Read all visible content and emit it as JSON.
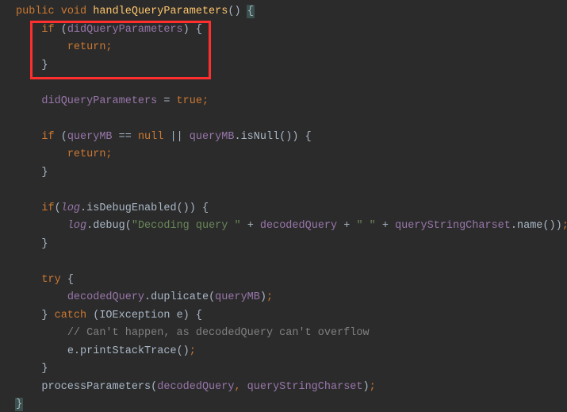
{
  "code": {
    "sig": {
      "public": "public",
      "void": "void",
      "name": "handleQueryParameters",
      "parens": "()",
      "ob": " {"
    },
    "if1": {
      "kw": "if",
      "open": " (",
      "var": "didQueryParameters",
      "close": ") {"
    },
    "ret1": {
      "kw": "return",
      "semi": ";"
    },
    "cb1": "}",
    "assign": {
      "var": "didQueryParameters",
      "eq": " = ",
      "val": "true",
      "semi": ";"
    },
    "if2": {
      "kw": "if",
      "open": " (",
      "var1": "queryMB",
      "eq1": " == ",
      "null1": "null",
      "or": " || ",
      "var2": "queryMB",
      "dot": ".",
      "call": "isNull",
      "parens": "()",
      "close": ") {"
    },
    "ret2": {
      "kw": "return",
      "semi": ";"
    },
    "cb2": "}",
    "if3": {
      "kw": "if",
      "open": "(",
      "var": "log",
      "dot": ".",
      "call": "isDebugEnabled",
      "parens": "()",
      "close": ") {"
    },
    "log": {
      "var": "log",
      "dot": ".",
      "call": "debug",
      "open": "(",
      "s1": "\"Decoding query \"",
      "p1": " + ",
      "v1": "decodedQuery",
      "p2": " + ",
      "s2": "\" \"",
      "p3": " + ",
      "v2": "queryStringCharset",
      "dot2": ".",
      "call2": "name",
      "parens2": "()",
      "close": ")",
      "semi": ";"
    },
    "cb3": "}",
    "try": {
      "kw": "try",
      "ob": " {"
    },
    "dup": {
      "v": "decodedQuery",
      "dot": ".",
      "call": "duplicate",
      "open": "(",
      "arg": "queryMB",
      "close": ")",
      "semi": ";"
    },
    "catch": {
      "cb": "} ",
      "kw": "catch",
      "open": " (",
      "type": "IOException",
      "sp": " ",
      "var": "e",
      "close": ") {"
    },
    "comment": "// Can't happen, as decodedQuery can't overflow",
    "pst": {
      "v": "e",
      "dot": ".",
      "call": "printStackTrace",
      "parens": "()",
      "semi": ";"
    },
    "cb4": "}",
    "pp": {
      "call": "processParameters",
      "open": "(",
      "a1": "decodedQuery",
      "comma": ", ",
      "a2": "queryStringCharset",
      "close": ")",
      "semi": ";"
    },
    "cb5": "}"
  }
}
